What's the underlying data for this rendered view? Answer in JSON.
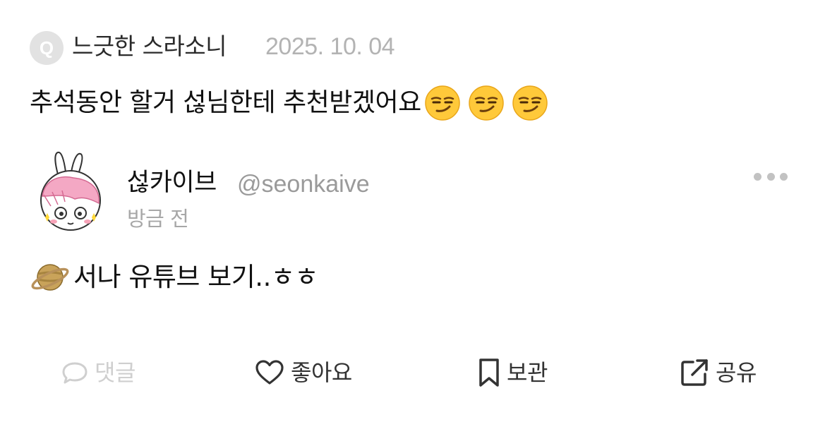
{
  "question": {
    "badge": "Q",
    "asker": "느긋한 스라소니",
    "date": "2025. 10. 04",
    "text": "추석동안 할거 섢님한테 추천받겠어요",
    "emojis": [
      "smirking-face",
      "smirking-face",
      "smirking-face"
    ]
  },
  "answer": {
    "author_name": "섢카이브",
    "author_handle": "@seonkaive",
    "time": "방금 전",
    "text": "서나 유튜브 보기..ㅎㅎ",
    "leading_emoji": "ringed-planet"
  },
  "actions": {
    "comment": "댓글",
    "like": "좋아요",
    "save": "보관",
    "share": "공유"
  },
  "colors": {
    "muted": "#b3b3b3",
    "disabled": "#cfcfcf",
    "emoji_yellow": "#ffcb3b"
  }
}
